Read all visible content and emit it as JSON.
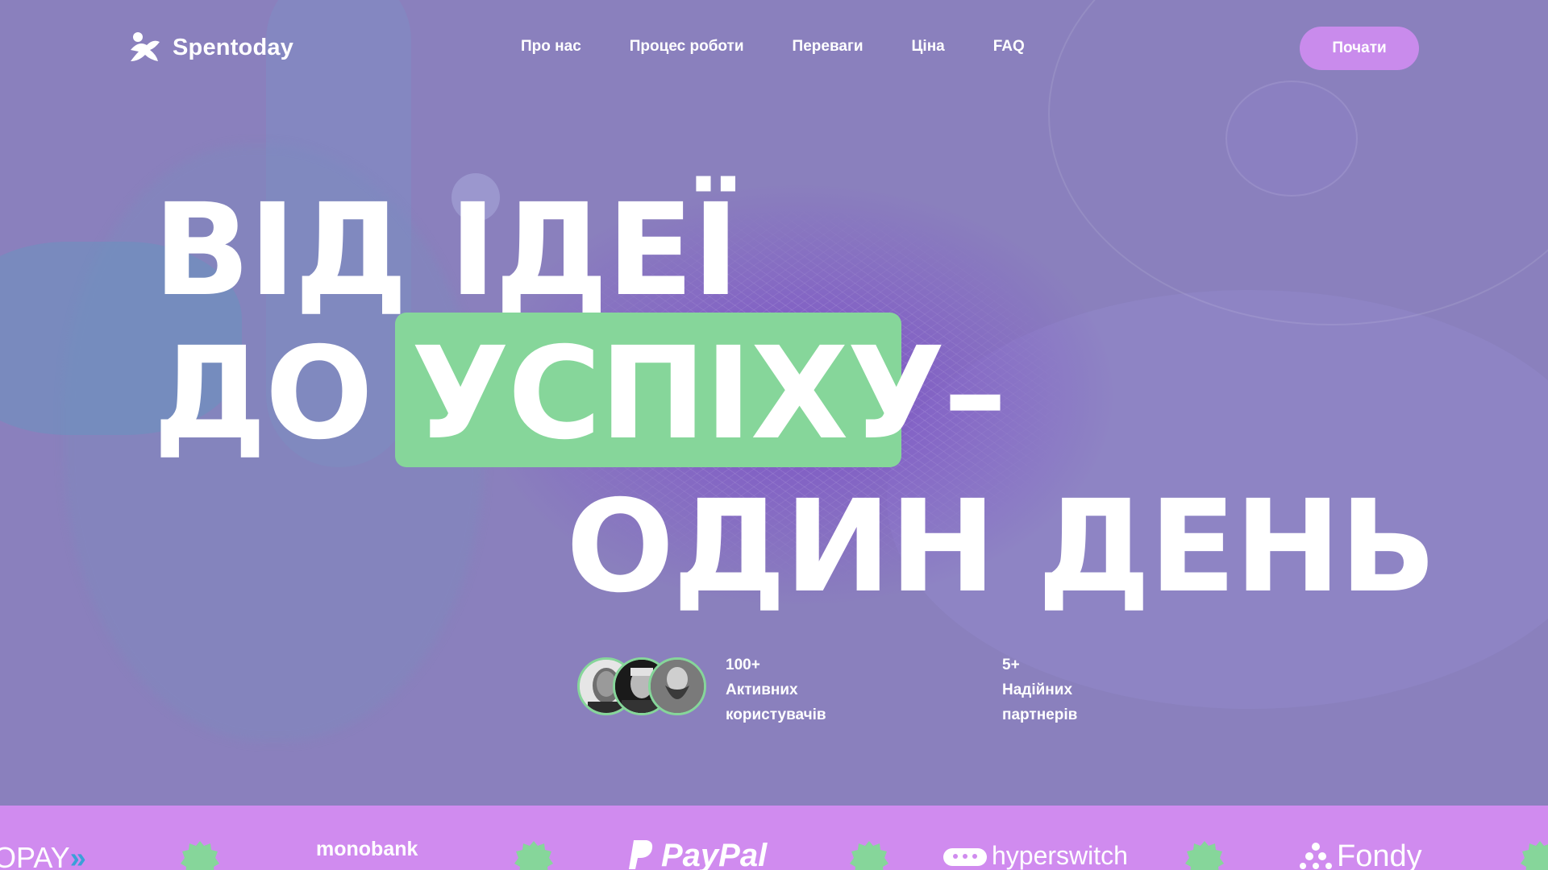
{
  "header": {
    "brand": "Spentoday",
    "nav": [
      {
        "label": "Про нас"
      },
      {
        "label": "Процес роботи"
      },
      {
        "label": "Переваги"
      },
      {
        "label": "Ціна"
      },
      {
        "label": "FAQ"
      }
    ],
    "cta_label": "Почати"
  },
  "hero": {
    "line1": "ВІД ІДЕЇ",
    "line2_prefix": "ДО",
    "line2_highlight": "УСПІХУ",
    "line2_suffix": "–",
    "line3": "ОДИН ДЕНЬ"
  },
  "stats": [
    {
      "value": "100+",
      "label_line1": "Активних",
      "label_line2": "користувачів"
    },
    {
      "value": "5+",
      "label_line1": "Надійних",
      "label_line2": "партнерів"
    }
  ],
  "partners": [
    {
      "name": "OPAY"
    },
    {
      "name": "monobank"
    },
    {
      "name": "PayPal"
    },
    {
      "name": "hyperswitch"
    },
    {
      "name": "Fondy"
    }
  ],
  "colors": {
    "background": "#8a80bd",
    "accent_green": "#86d69a",
    "accent_pink": "#c98bec",
    "strip": "#d08bef"
  },
  "icons": [
    "logo-icon",
    "avatar-user-1",
    "avatar-user-2",
    "avatar-user-3",
    "partner-badge-icon"
  ]
}
